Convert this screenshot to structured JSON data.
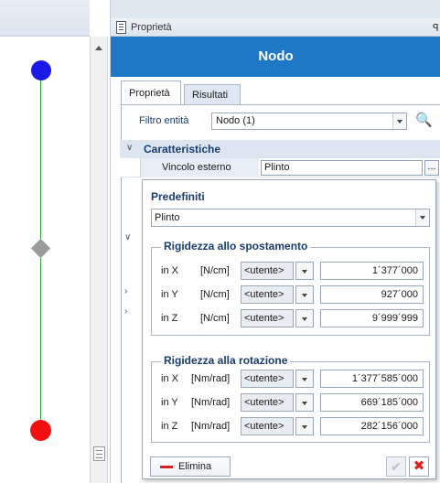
{
  "panel": {
    "header_label": "Proprietà",
    "title": "Nodo"
  },
  "tabs": [
    {
      "label": "Proprietà",
      "active": true
    },
    {
      "label": "Risultati",
      "active": false
    }
  ],
  "filter": {
    "label": "Filtro entità",
    "value": "Nodo (1)"
  },
  "section": {
    "title": "Caratteristiche",
    "property_name": "Vincolo esterno",
    "property_value": "Plinto",
    "ellipsis": "..."
  },
  "popup": {
    "presets_label": "Predefiniti",
    "preset_value": "Plinto",
    "translation": {
      "title": "Rigidezza allo spostamento",
      "rows": [
        {
          "axis": "in X",
          "unit": "[N/cm]",
          "mode": "<utente>",
          "value": "1´377´000"
        },
        {
          "axis": "in Y",
          "unit": "[N/cm]",
          "mode": "<utente>",
          "value": "927´000"
        },
        {
          "axis": "in Z",
          "unit": "[N/cm]",
          "mode": "<utente>",
          "value": "9´999´999"
        }
      ]
    },
    "rotation": {
      "title": "Rigidezza alla rotazione",
      "rows": [
        {
          "axis": "in X",
          "unit": "[Nm/rad]",
          "mode": "<utente>",
          "value": "1´377´585´000"
        },
        {
          "axis": "in Y",
          "unit": "[Nm/rad]",
          "mode": "<utente>",
          "value": "669´185´000"
        },
        {
          "axis": "in Z",
          "unit": "[Nm/rad]",
          "mode": "<utente>",
          "value": "282´156´000"
        }
      ]
    },
    "delete_label": "Elimina"
  },
  "colors": {
    "accent": "#1f77c8",
    "node_top": "#1a1ae6",
    "node_bottom": "#f01010",
    "beam": "#3aa53a",
    "delete": "#d62020"
  }
}
